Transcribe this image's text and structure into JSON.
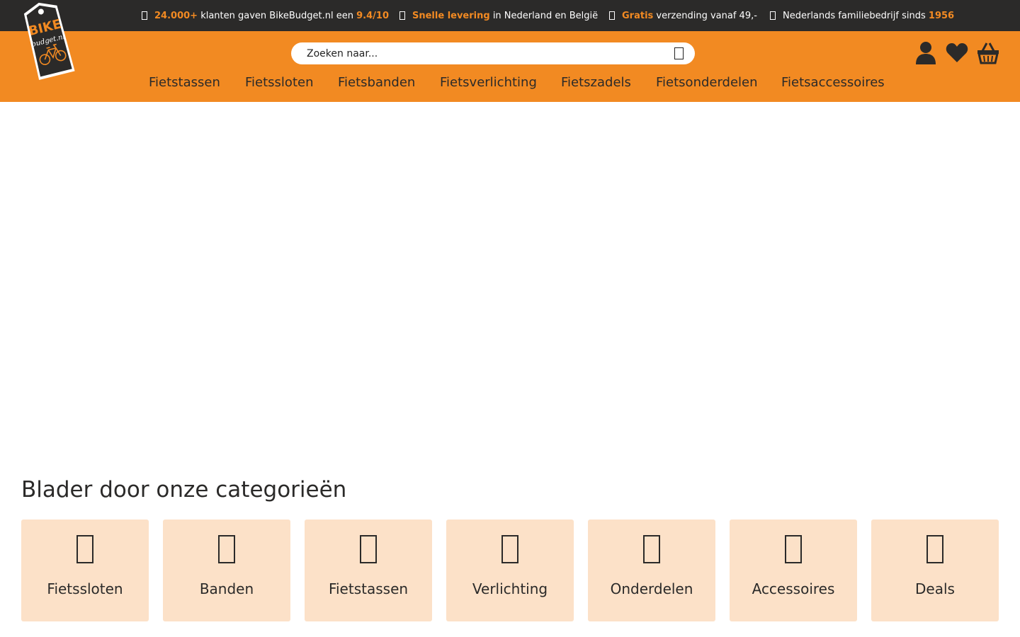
{
  "topbar": {
    "usps": [
      {
        "highlight": "24.000+",
        "text": " klanten gaven BikeBudget.nl een ",
        "highlight2": "9.4/10"
      },
      {
        "highlight": "Snelle levering",
        "text": " in Nederland en België"
      },
      {
        "highlight": "Gratis",
        "text": " verzending vanaf 49,-"
      },
      {
        "text": "Nederlands familiebedrijf sinds ",
        "highlight2": "1956"
      }
    ]
  },
  "header": {
    "logo_line1": "BIKE",
    "logo_line2": "budget.nl",
    "search": {
      "placeholder": "Zoeken naar..."
    },
    "icons": [
      "user-icon",
      "heart-icon",
      "basket-icon"
    ]
  },
  "nav": {
    "items": [
      "Fietstassen",
      "Fietssloten",
      "Fietsbanden",
      "Fietsverlichting",
      "Fietszadels",
      "Fietsonderdelen",
      "Fietsaccessoires"
    ]
  },
  "categories": {
    "title": "Blader door onze categorieën",
    "items": [
      {
        "label": "Fietssloten",
        "icon": "lock-icon"
      },
      {
        "label": "Banden",
        "icon": "tire-icon"
      },
      {
        "label": "Fietstassen",
        "icon": "bag-icon"
      },
      {
        "label": "Verlichting",
        "icon": "light-icon"
      },
      {
        "label": "Onderdelen",
        "icon": "parts-icon"
      },
      {
        "label": "Accessoires",
        "icon": "accessories-icon"
      },
      {
        "label": "Deals",
        "icon": "deals-icon"
      }
    ]
  },
  "colors": {
    "brand_orange": "#f28a22",
    "topbar_dark": "#2b2a29",
    "category_bg": "#fce1c8"
  }
}
